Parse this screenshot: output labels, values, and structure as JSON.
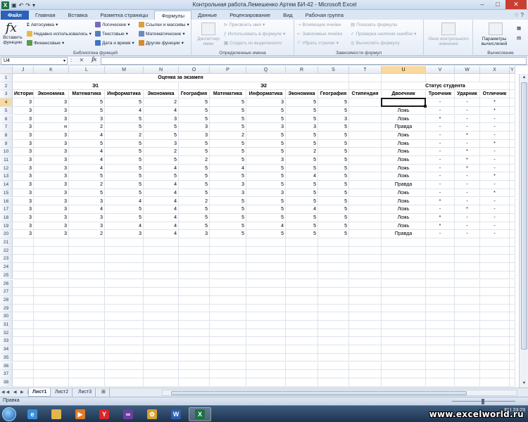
{
  "window": {
    "title": "Контрольная работа.Лемешенко Артем БИ-42 - Microsoft Excel",
    "qat": [
      "save-icon",
      "undo-icon",
      "redo-icon"
    ]
  },
  "tabs": [
    {
      "label": "Файл",
      "kind": "file"
    },
    {
      "label": "Главная"
    },
    {
      "label": "Вставка"
    },
    {
      "label": "Разметка страницы"
    },
    {
      "label": "Формулы",
      "active": true
    },
    {
      "label": "Данные"
    },
    {
      "label": "Рецензирование"
    },
    {
      "label": "Вид"
    },
    {
      "label": "Рабочая группа"
    }
  ],
  "ribbon": {
    "insert_function": "Вставить функцию",
    "autosum": "Автосумма",
    "recent": "Недавно использовались",
    "financial": "Финансовые",
    "logical": "Логические",
    "text": "Текстовые",
    "datetime": "Дата и время",
    "lookup": "Ссылки и массивы",
    "math": "Математические",
    "other": "Другие функции",
    "library_label": "Библиотека функций",
    "name_manager": "Диспетчер имен",
    "define_name": "Присвоить имя",
    "use_in_formula": "Использовать в формуле",
    "create_from_sel": "Создать из выделенного",
    "names_label": "Определенные имена",
    "trace_precedents": "Влияющие ячейки",
    "trace_dependents": "Зависимые ячейки",
    "remove_arrows": "Убрать стрелки",
    "show_formulas": "Показать формулы",
    "error_check": "Проверка наличия ошибок",
    "evaluate": "Вычислить формулу",
    "audit_label": "Зависимости формул",
    "watch": "Окно контрольного значения",
    "calc_options": "Параметры вычислений",
    "calc_label": "Вычисление"
  },
  "formula_bar": {
    "name_box": "U4",
    "fx": "fx",
    "value": ""
  },
  "columns": [
    {
      "letter": "J",
      "w": 30
    },
    {
      "letter": "K",
      "w": 50
    },
    {
      "letter": "L",
      "w": 51
    },
    {
      "letter": "M",
      "w": 55
    },
    {
      "letter": "N",
      "w": 50
    },
    {
      "letter": "O",
      "w": 44
    },
    {
      "letter": "P",
      "w": 52
    },
    {
      "letter": "Q",
      "w": 56
    },
    {
      "letter": "R",
      "w": 46
    },
    {
      "letter": "S",
      "w": 44
    },
    {
      "letter": "T",
      "w": 46
    },
    {
      "letter": "U",
      "w": 63
    },
    {
      "letter": "V",
      "w": 41
    },
    {
      "letter": "W",
      "w": 36
    },
    {
      "letter": "X",
      "w": 42
    },
    {
      "letter": "Y",
      "w": 8
    }
  ],
  "selected_cell": "U4",
  "headers": {
    "row1_title": "Оценка за экзамен",
    "e1": "Э1",
    "e2": "Э2",
    "status_title": "Статус студента",
    "row3": [
      "История",
      "Экономика",
      "Математика",
      "Информатика",
      "Экономика",
      "География",
      "Математика",
      "Информатика",
      "Экономика",
      "География",
      "Стипендия",
      "Двоечник",
      "Троечник",
      "Ударник",
      "Отличник"
    ]
  },
  "rows": [
    {
      "n": 4,
      "g": [
        "3",
        "3",
        "5",
        "5",
        "2",
        "5",
        "5",
        "3",
        "5",
        "5"
      ],
      "s": [
        "",
        "",
        "-",
        "-",
        "*"
      ]
    },
    {
      "n": 5,
      "g": [
        "3",
        "3",
        "5",
        "4",
        "4",
        "5",
        "5",
        "5",
        "5",
        "5"
      ],
      "s": [
        "",
        "Ложь",
        "-",
        "-",
        "*"
      ]
    },
    {
      "n": 6,
      "g": [
        "3",
        "3",
        "3",
        "5",
        "3",
        "5",
        "5",
        "5",
        "5",
        "3"
      ],
      "s": [
        "",
        "Ложь",
        "*",
        "-",
        "-"
      ]
    },
    {
      "n": 7,
      "g": [
        "3",
        "н",
        "2",
        "5",
        "5",
        "3",
        "5",
        "3",
        "3",
        "5"
      ],
      "s": [
        "",
        "Правда",
        "-",
        "-",
        "-"
      ]
    },
    {
      "n": 8,
      "g": [
        "3",
        "3",
        "4",
        "2",
        "5",
        "3",
        "2",
        "5",
        "5",
        "5"
      ],
      "s": [
        "",
        "Ложь",
        "-",
        "*",
        "-"
      ]
    },
    {
      "n": 9,
      "g": [
        "3",
        "3",
        "5",
        "5",
        "3",
        "5",
        "5",
        "5",
        "5",
        "5"
      ],
      "s": [
        "",
        "Ложь",
        "-",
        "-",
        "*"
      ]
    },
    {
      "n": 10,
      "g": [
        "3",
        "3",
        "4",
        "5",
        "2",
        "5",
        "5",
        "5",
        "2",
        "5"
      ],
      "s": [
        "",
        "Ложь",
        "-",
        "*",
        "-"
      ]
    },
    {
      "n": 11,
      "g": [
        "3",
        "3",
        "4",
        "5",
        "5",
        "2",
        "5",
        "3",
        "5",
        "5"
      ],
      "s": [
        "",
        "Ложь",
        "-",
        "*",
        "-"
      ]
    },
    {
      "n": 12,
      "g": [
        "3",
        "3",
        "4",
        "5",
        "4",
        "5",
        "4",
        "5",
        "5",
        "5"
      ],
      "s": [
        "",
        "Ложь",
        "-",
        "*",
        "-"
      ]
    },
    {
      "n": 13,
      "g": [
        "3",
        "3",
        "5",
        "5",
        "5",
        "5",
        "5",
        "5",
        "4",
        "5"
      ],
      "s": [
        "",
        "Ложь",
        "-",
        "-",
        "*"
      ]
    },
    {
      "n": 14,
      "g": [
        "3",
        "3",
        "2",
        "5",
        "4",
        "5",
        "3",
        "5",
        "5",
        "5"
      ],
      "s": [
        "",
        "Правда",
        "-",
        "-",
        "-"
      ]
    },
    {
      "n": 15,
      "g": [
        "3",
        "3",
        "5",
        "5",
        "4",
        "5",
        "3",
        "3",
        "5",
        "5"
      ],
      "s": [
        "",
        "Ложь",
        "-",
        "-",
        "*"
      ]
    },
    {
      "n": 16,
      "g": [
        "3",
        "3",
        "3",
        "4",
        "4",
        "2",
        "5",
        "5",
        "5",
        "5"
      ],
      "s": [
        "",
        "Ложь",
        "*",
        "-",
        "-"
      ]
    },
    {
      "n": 17,
      "g": [
        "3",
        "3",
        "4",
        "5",
        "4",
        "5",
        "5",
        "5",
        "4",
        "5"
      ],
      "s": [
        "",
        "Ложь",
        "-",
        "*",
        "-"
      ]
    },
    {
      "n": 18,
      "g": [
        "3",
        "3",
        "3",
        "5",
        "4",
        "5",
        "5",
        "5",
        "5",
        "5"
      ],
      "s": [
        "",
        "Ложь",
        "*",
        "-",
        "-"
      ]
    },
    {
      "n": 19,
      "g": [
        "3",
        "3",
        "3",
        "4",
        "4",
        "5",
        "5",
        "4",
        "5",
        "5"
      ],
      "s": [
        "",
        "Ложь",
        "*",
        "-",
        "-"
      ]
    },
    {
      "n": 20,
      "g": [
        "3",
        "3",
        "2",
        "3",
        "4",
        "3",
        "5",
        "5",
        "5",
        "5"
      ],
      "s": [
        "",
        "Правда",
        "-",
        "-",
        "-"
      ]
    }
  ],
  "empty_rows_to": 38,
  "sheets": [
    "Лист1",
    "Лист2",
    "Лист3"
  ],
  "active_sheet": "Лист1",
  "status": "Правка",
  "tray": {
    "lang": "RU",
    "time": "23:23"
  },
  "watermark": "www.excelworld.ru"
}
